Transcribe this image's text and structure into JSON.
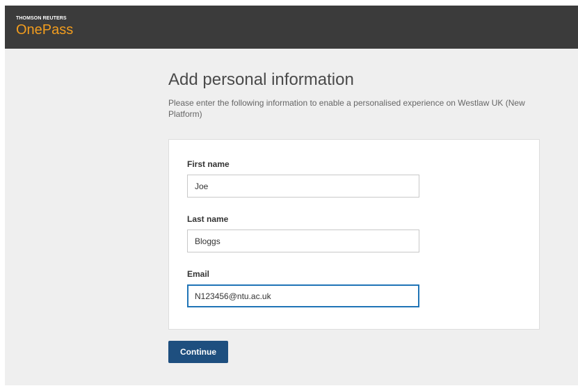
{
  "header": {
    "company": "THOMSON REUTERS",
    "product": "OnePass",
    "product_color": "#f29d1e",
    "bar_color": "#3b3b3b"
  },
  "main": {
    "title": "Add personal information",
    "description": "Please enter the following information to enable a personalised experience on Westlaw UK (New Platform)"
  },
  "form": {
    "first_name": {
      "label": "First name",
      "value": "Joe"
    },
    "last_name": {
      "label": "Last name",
      "value": "Bloggs"
    },
    "email": {
      "label": "Email",
      "value": "N123456@ntu.ac.uk",
      "focused": true
    }
  },
  "actions": {
    "continue_label": "Continue",
    "continue_color": "#1e4f7f"
  }
}
